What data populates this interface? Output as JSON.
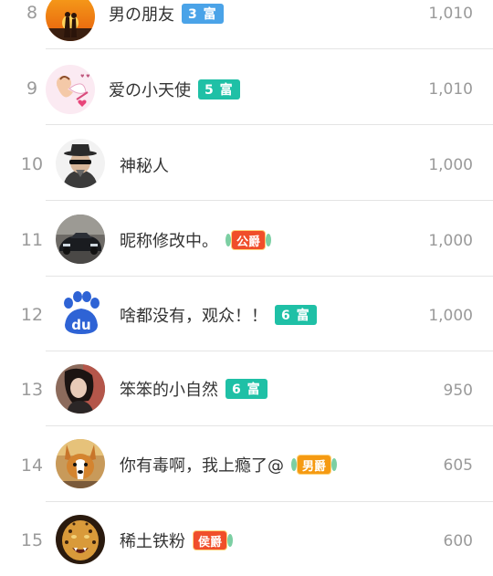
{
  "colors": {
    "fortune_blue": "#4aa3e8",
    "fortune_teal": "#1fc0a6",
    "duke_red": "#f04e2a",
    "marquis_red": "#f04e2a",
    "baron_orange": "#f59a12"
  },
  "rows": [
    {
      "rank": "8",
      "name": "男の朋友",
      "badge": "3 富",
      "badge_type": "fortune",
      "badge_color": "#4aa3e8",
      "score": "1,010",
      "avatar_icon": "sunset-couple-avatar"
    },
    {
      "rank": "9",
      "name": "爱の小天使",
      "badge": "5 富",
      "badge_type": "fortune",
      "badge_color": "#1fc0a6",
      "score": "1,010",
      "avatar_icon": "cupid-avatar"
    },
    {
      "rank": "10",
      "name": "神秘人",
      "badge": "",
      "badge_type": "none",
      "badge_color": "",
      "score": "1,000",
      "avatar_icon": "mystery-man-avatar"
    },
    {
      "rank": "11",
      "name": "昵称修改中。",
      "badge": "公爵",
      "badge_type": "noble",
      "badge_color": "#f04e2a",
      "score": "1,000",
      "avatar_icon": "sports-car-avatar"
    },
    {
      "rank": "12",
      "name": "啥都没有，观众！！",
      "badge": "6 富",
      "badge_type": "fortune",
      "badge_color": "#1fc0a6",
      "score": "1,000",
      "avatar_icon": "baidu-paw-avatar"
    },
    {
      "rank": "13",
      "name": "笨笨的小自然",
      "badge": "6 富",
      "badge_type": "fortune",
      "badge_color": "#1fc0a6",
      "score": "950",
      "avatar_icon": "woman-portrait-avatar"
    },
    {
      "rank": "14",
      "name": "你有毒啊，我上瘾了@",
      "badge": "男爵",
      "badge_type": "noble",
      "badge_color": "#f59a12",
      "score": "605",
      "avatar_icon": "corgi-dog-avatar"
    },
    {
      "rank": "15",
      "name": "稀土铁粉",
      "badge": "侯爵",
      "badge_type": "noble",
      "badge_color": "#f04e2a",
      "score": "600",
      "avatar_icon": "leopard-avatar"
    }
  ]
}
